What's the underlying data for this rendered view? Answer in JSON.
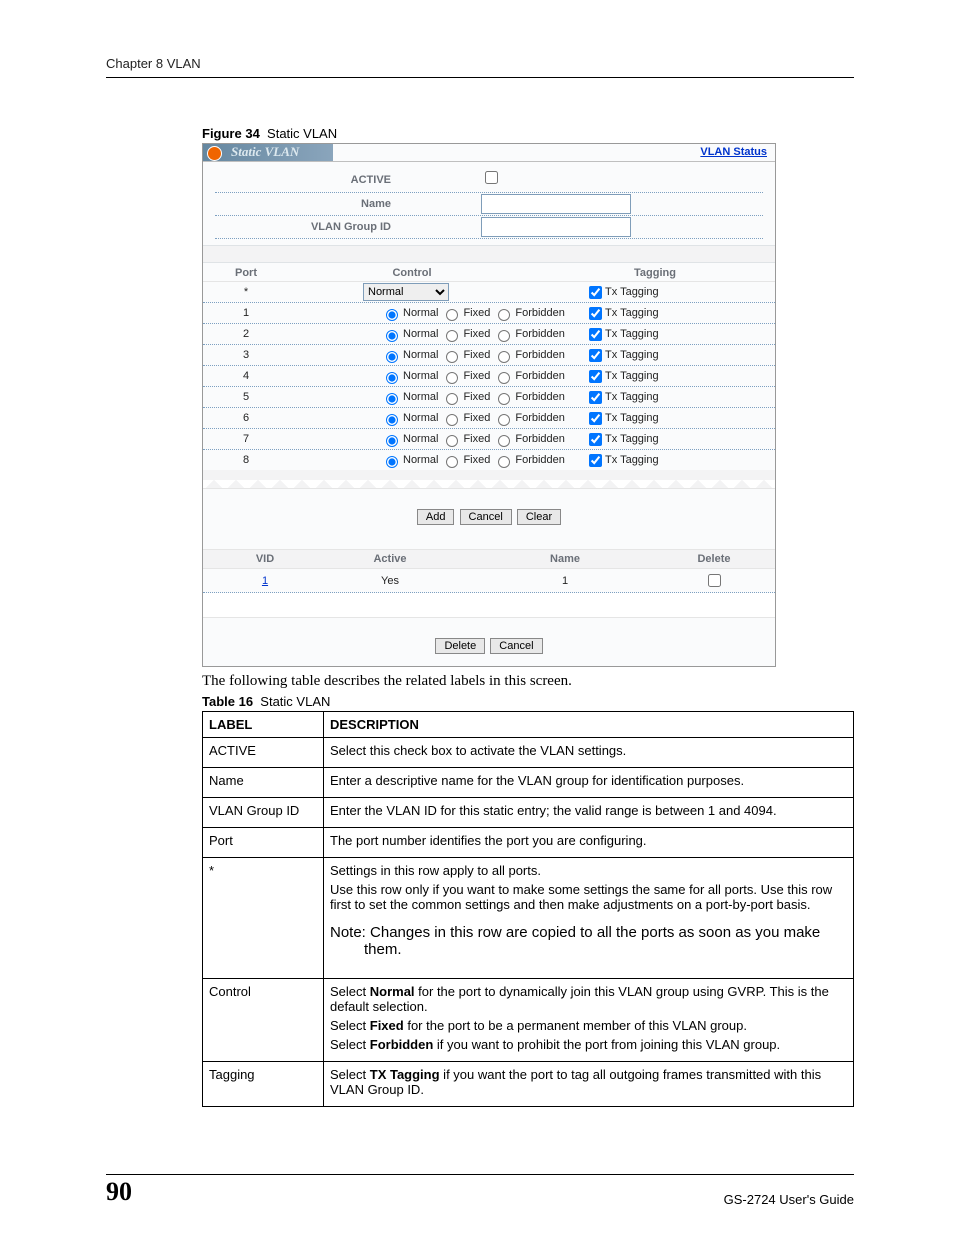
{
  "header": {
    "chapter": "Chapter 8 VLAN"
  },
  "figure": {
    "num": "Figure 34",
    "title": "Static VLAN"
  },
  "screenshot": {
    "title_tab": "Static VLAN",
    "link": "VLAN Status",
    "fields": {
      "active_label": "ACTIVE",
      "name_label": "Name",
      "group_label": "VLAN Group ID"
    },
    "port_header": {
      "port": "Port",
      "control": "Control",
      "tagging": "Tagging"
    },
    "star_row": {
      "port": "*",
      "dropdown": "Normal",
      "tag": "Tx Tagging"
    },
    "opts": {
      "normal": "Normal",
      "fixed": "Fixed",
      "forbidden": "Forbidden",
      "tag": "Tx Tagging"
    },
    "ports": [
      "1",
      "2",
      "3",
      "4",
      "5",
      "6",
      "7",
      "8"
    ],
    "buttons1": {
      "add": "Add",
      "cancel": "Cancel",
      "clear": "Clear"
    },
    "list_header": {
      "vid": "VID",
      "active": "Active",
      "name": "Name",
      "delete": "Delete"
    },
    "list_row": {
      "vid": "1",
      "active": "Yes",
      "name": "1"
    },
    "buttons2": {
      "delete": "Delete",
      "cancel": "Cancel"
    }
  },
  "lead": "The following table describes the related labels in this screen.",
  "table_caption": {
    "num": "Table 16",
    "title": "Static VLAN"
  },
  "table_head": {
    "label": "LABEL",
    "desc": "DESCRIPTION"
  },
  "rows": [
    {
      "label": "ACTIVE",
      "desc": [
        "Select this check box to activate the VLAN settings."
      ]
    },
    {
      "label": "Name",
      "desc": [
        "Enter a descriptive name for the VLAN group for identification purposes."
      ]
    },
    {
      "label": "VLAN Group ID",
      "desc": [
        "Enter the VLAN ID for this static entry; the valid range is between 1 and 4094."
      ]
    },
    {
      "label": "Port",
      "desc": [
        "The port number identifies the port you are configuring."
      ]
    },
    {
      "label": "*",
      "desc": [
        "Settings in this row apply to all ports.",
        "Use this row only if you want to make some settings the same for all ports. Use this row first to set the common settings and then make adjustments on a port-by-port basis."
      ],
      "note": "Note: Changes in this row are copied to all the ports as soon as you make them."
    },
    {
      "label": "Control",
      "lines": [
        {
          "pre": "Select ",
          "b": "Normal",
          "post": " for the port to dynamically join this VLAN group using GVRP. This is the default selection."
        },
        {
          "pre": "Select ",
          "b": "Fixed",
          "post": " for the port to be a permanent member of this VLAN group."
        },
        {
          "pre": "Select ",
          "b": "Forbidden",
          "post": " if you want to prohibit the port from joining this VLAN group."
        }
      ]
    },
    {
      "label": "Tagging",
      "lines": [
        {
          "pre": "Select ",
          "b": "TX Tagging",
          "post": " if you want the port to tag all outgoing frames transmitted with this VLAN Group ID."
        }
      ]
    }
  ],
  "footer": {
    "page": "90",
    "guide": "GS-2724 User's Guide"
  }
}
